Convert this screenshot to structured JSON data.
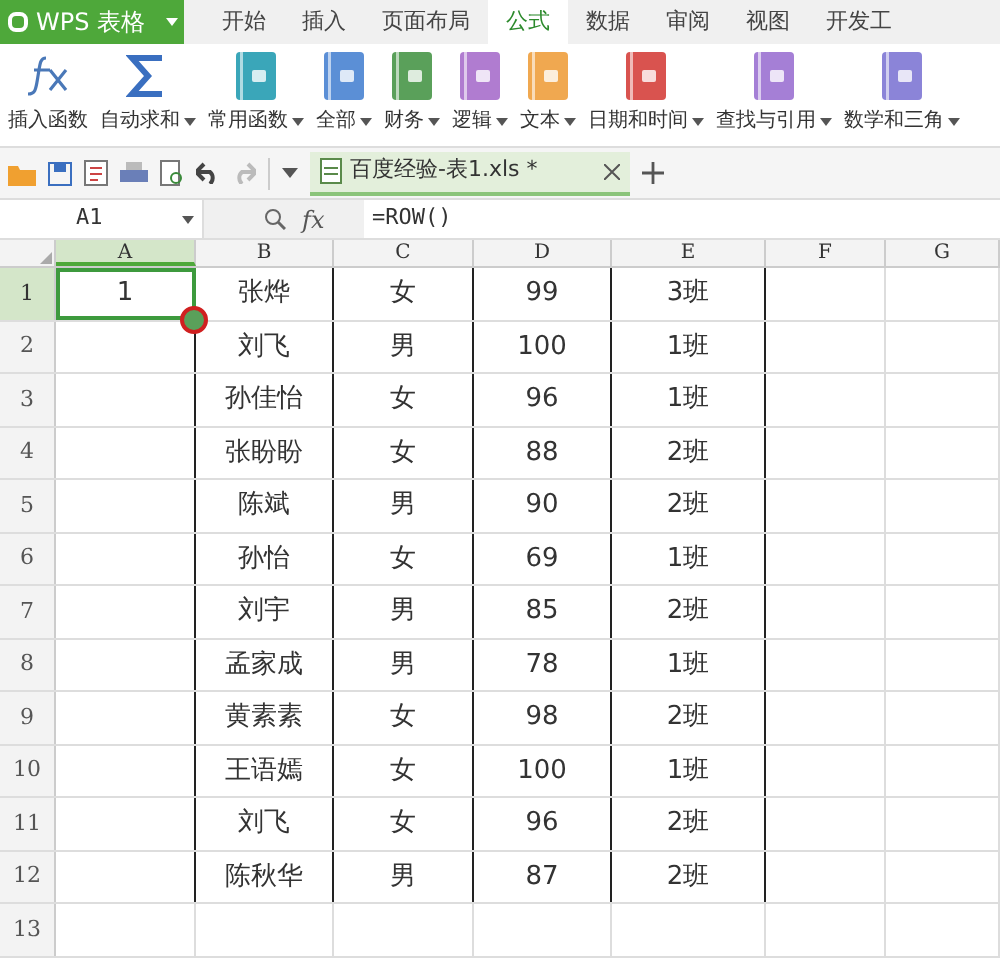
{
  "app_button": {
    "label": "WPS 表格"
  },
  "tabs": [
    {
      "label": "开始",
      "selected": false
    },
    {
      "label": "插入",
      "selected": false
    },
    {
      "label": "页面布局",
      "selected": false
    },
    {
      "label": "公式",
      "selected": true
    },
    {
      "label": "数据",
      "selected": false
    },
    {
      "label": "审阅",
      "selected": false
    },
    {
      "label": "视图",
      "selected": false
    },
    {
      "label": "开发工",
      "selected": false
    }
  ],
  "ribbon": [
    {
      "label": "插入函数",
      "kind": "fx",
      "dropdown": false
    },
    {
      "label": "自动求和",
      "kind": "sigma",
      "dropdown": true
    },
    {
      "label": "常用函数",
      "kind": "book",
      "color": "#3aa6b9",
      "dropdown": true
    },
    {
      "label": "全部",
      "kind": "book",
      "color": "#5b8fd6",
      "dropdown": true
    },
    {
      "label": "财务",
      "kind": "book",
      "color": "#5aa05a",
      "dropdown": true
    },
    {
      "label": "逻辑",
      "kind": "book",
      "color": "#b07cd0",
      "dropdown": true
    },
    {
      "label": "文本",
      "kind": "book",
      "color": "#f0a850",
      "dropdown": true
    },
    {
      "label": "日期和时间",
      "kind": "book",
      "color": "#d9534f",
      "dropdown": true
    },
    {
      "label": "查找与引用",
      "kind": "book",
      "color": "#a57fd6",
      "dropdown": true
    },
    {
      "label": "数学和三角",
      "kind": "book",
      "color": "#8b84d8",
      "dropdown": true
    }
  ],
  "document_tab": {
    "title": "百度经验-表1.xls *"
  },
  "formula_bar": {
    "name_box": "A1",
    "fx": "fx",
    "formula": "=ROW()"
  },
  "columns": [
    {
      "label": "A",
      "selected": true
    },
    {
      "label": "B",
      "selected": false
    },
    {
      "label": "C",
      "selected": false
    },
    {
      "label": "D",
      "selected": false
    },
    {
      "label": "E",
      "selected": false
    },
    {
      "label": "F",
      "selected": false
    },
    {
      "label": "G",
      "selected": false
    }
  ],
  "rows": [
    {
      "number": "1",
      "selected": true,
      "column_a": "1",
      "column_b": "张烨",
      "column_c": "女",
      "column_d": "99",
      "column_e": "3班"
    },
    {
      "number": "2",
      "selected": false,
      "column_b": "刘飞",
      "column_c": "男",
      "column_d": "100",
      "column_e": "1班"
    },
    {
      "number": "3",
      "selected": false,
      "column_b": "孙佳怡",
      "column_c": "女",
      "column_d": "96",
      "column_e": "1班"
    },
    {
      "number": "4",
      "selected": false,
      "column_b": "张盼盼",
      "column_c": "女",
      "column_d": "88",
      "column_e": "2班"
    },
    {
      "number": "5",
      "selected": false,
      "column_b": "陈斌",
      "column_c": "男",
      "column_d": "90",
      "column_e": "2班"
    },
    {
      "number": "6",
      "selected": false,
      "column_b": "孙怡",
      "column_c": "女",
      "column_d": "69",
      "column_e": "1班"
    },
    {
      "number": "7",
      "selected": false,
      "column_b": "刘宇",
      "column_c": "男",
      "column_d": "85",
      "column_e": "2班"
    },
    {
      "number": "8",
      "selected": false,
      "column_b": "孟家成",
      "column_c": "男",
      "column_d": "78",
      "column_e": "1班"
    },
    {
      "number": "9",
      "selected": false,
      "column_b": "黄素素",
      "column_c": "女",
      "column_d": "98",
      "column_e": "2班"
    },
    {
      "number": "10",
      "selected": false,
      "column_b": "王语嫣",
      "column_c": "女",
      "column_d": "100",
      "column_e": "1班"
    },
    {
      "number": "11",
      "selected": false,
      "column_b": "刘飞",
      "column_c": "女",
      "column_d": "96",
      "column_e": "2班"
    },
    {
      "number": "12",
      "selected": false,
      "column_b": "陈秋华",
      "column_c": "男",
      "column_d": "87",
      "column_e": "2班"
    },
    {
      "number": "13",
      "selected": false
    }
  ]
}
